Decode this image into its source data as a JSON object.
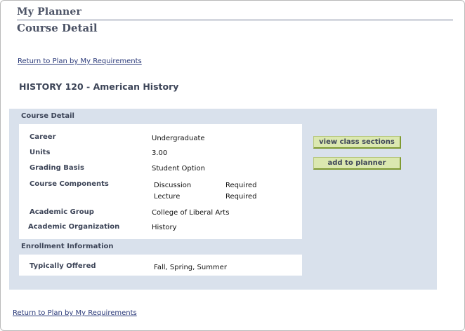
{
  "header": {
    "app_title": "My Planner",
    "page_title": "Course Detail"
  },
  "links": {
    "return_top": "Return to Plan by My Requirements",
    "return_bottom": "Return to Plan by My Requirements"
  },
  "course": {
    "heading": "HISTORY  120 - American History"
  },
  "course_detail": {
    "section_label": "Course Detail",
    "career_label": "Career",
    "career_value": "Undergraduate",
    "units_label": "Units",
    "units_value": "3.00",
    "grading_label": "Grading Basis",
    "grading_value": "Student Option",
    "components_label": "Course Components",
    "components": [
      {
        "name": "Discussion",
        "status": "Required"
      },
      {
        "name": "Lecture",
        "status": "Required"
      }
    ],
    "acad_group_label": "Academic Group",
    "acad_group_value": "College of Liberal Arts",
    "acad_org_label": "Academic Organization",
    "acad_org_value": "History"
  },
  "enrollment": {
    "section_label": "Enrollment Information",
    "offered_label": "Typically Offered",
    "offered_value": "Fall, Spring, Summer"
  },
  "actions": {
    "view_sections": "view class sections",
    "add_to_planner": "add to planner"
  }
}
